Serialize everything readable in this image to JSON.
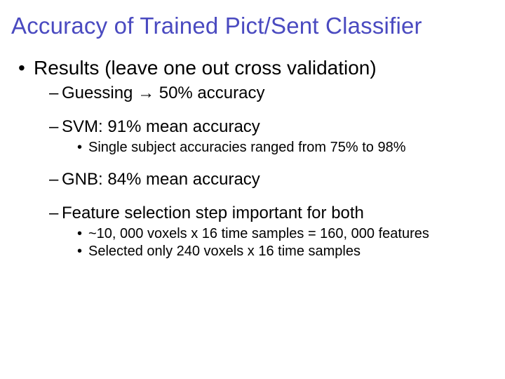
{
  "title": "Accuracy of Trained Pict/Sent Classifier",
  "bullets": {
    "results_heading": "Results (leave one out cross validation)",
    "guessing": "Guessing ",
    "guessing_arrow": "→",
    "guessing_tail": " 50% accuracy",
    "svm": "SVM: 91% mean accuracy",
    "svm_sub": "Single subject accuracies ranged from 75% to 98%",
    "gnb": "GNB: 84% mean accuracy",
    "feature": "Feature selection step important for both",
    "feature_sub1": "~10, 000 voxels x 16 time samples = 160, 000 features",
    "feature_sub2": "Selected only 240 voxels x 16 time samples"
  }
}
